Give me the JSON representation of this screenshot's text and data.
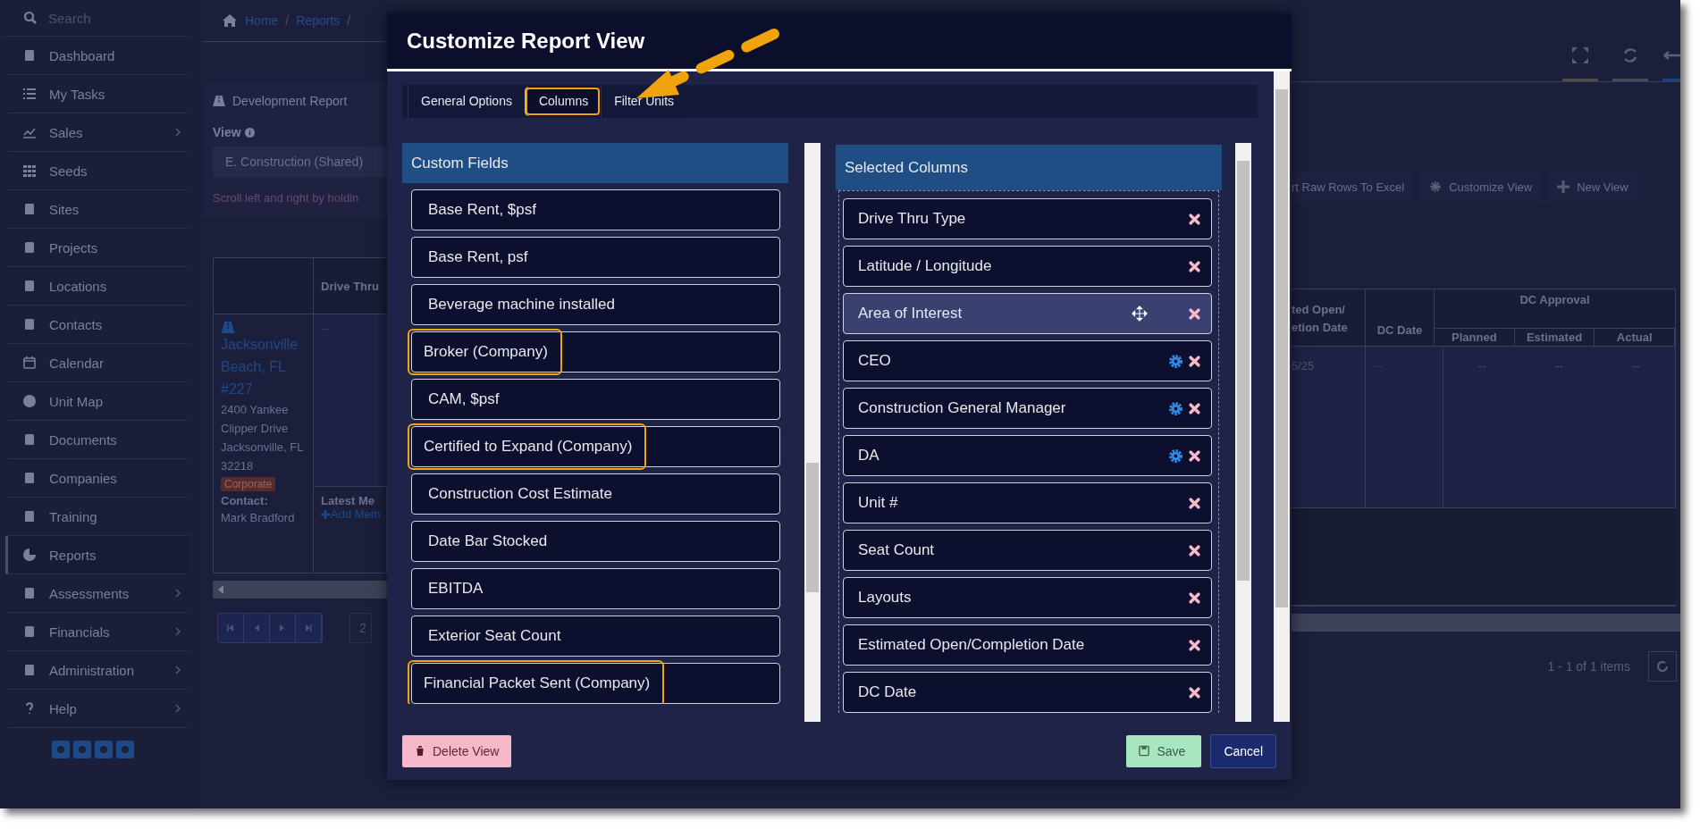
{
  "sidebar": {
    "search_placeholder": "Search",
    "items": [
      {
        "label": "Dashboard",
        "submenu": false,
        "selected": false
      },
      {
        "label": "My Tasks",
        "submenu": false,
        "selected": false
      },
      {
        "label": "Sales",
        "submenu": true,
        "selected": false
      },
      {
        "label": "Seeds",
        "submenu": false,
        "selected": false
      },
      {
        "label": "Sites",
        "submenu": false,
        "selected": false
      },
      {
        "label": "Projects",
        "submenu": false,
        "selected": false
      },
      {
        "label": "Locations",
        "submenu": false,
        "selected": false
      },
      {
        "label": "Contacts",
        "submenu": false,
        "selected": false
      },
      {
        "label": "Calendar",
        "submenu": false,
        "selected": false
      },
      {
        "label": "Unit Map",
        "submenu": false,
        "selected": false
      },
      {
        "label": "Documents",
        "submenu": false,
        "selected": false
      },
      {
        "label": "Companies",
        "submenu": false,
        "selected": false
      },
      {
        "label": "Training",
        "submenu": false,
        "selected": false
      },
      {
        "label": "Reports",
        "submenu": false,
        "selected": true
      },
      {
        "label": "Assessments",
        "submenu": true,
        "selected": false
      },
      {
        "label": "Financials",
        "submenu": true,
        "selected": false
      },
      {
        "label": "Administration",
        "submenu": true,
        "selected": false
      },
      {
        "label": "Help",
        "submenu": true,
        "selected": false
      }
    ]
  },
  "breadcrumb": {
    "items": [
      "Home",
      "Reports"
    ],
    "separator": "/"
  },
  "report": {
    "title": "Development Report",
    "view_label": "View",
    "view_value": "E. Construction (Shared)",
    "hint": "Scroll left and right by holdin"
  },
  "toolbar": [
    {
      "label": "rt Raw Rows To Excel",
      "kind": "plain"
    },
    {
      "label": "Customize View",
      "kind": "gear"
    },
    {
      "label": "New View",
      "kind": "plus"
    }
  ],
  "table": {
    "drive_thru_header": "Drive Thru",
    "unit_link": "Jacksonville Beach, FL #227",
    "address": "2400 Yankee Clipper Drive Jacksonville, FL 32218",
    "tag": "Corporate",
    "contact_label": "Contact:",
    "contact_name": "Mark Bradford",
    "drive_thru_value": "--",
    "memo_label": "Latest Me",
    "memo_link": "Add Mem",
    "est_open_header": [
      "ted Open/",
      "etion Date"
    ],
    "dc_date_header": "DC Date",
    "dc_approval_header": "DC Approval",
    "dc_subcolumns": [
      "Planned",
      "Estimated",
      "Actual"
    ],
    "est_open_value": "5/25",
    "dc_date_value": "--",
    "dc_values": [
      "--",
      "--",
      "--"
    ]
  },
  "pagination": {
    "page": "2",
    "summary": "1 - 1 of 1 items"
  },
  "modal": {
    "title": "Customize Report View",
    "tabs": [
      {
        "label": "General Options",
        "selected": false,
        "highlighted": false
      },
      {
        "label": "Columns",
        "selected": true,
        "highlighted": true
      },
      {
        "label": "Filter Units",
        "selected": false,
        "highlighted": false
      }
    ],
    "custom_fields": {
      "title": "Custom Fields",
      "items": [
        {
          "label": "Base Rent, $psf",
          "highlighted": false
        },
        {
          "label": "Base Rent, psf",
          "highlighted": false
        },
        {
          "label": "Beverage machine installed",
          "highlighted": false
        },
        {
          "label": "Broker (Company)",
          "highlighted": true
        },
        {
          "label": "CAM, $psf",
          "highlighted": false
        },
        {
          "label": "Certified to Expand (Company)",
          "highlighted": true
        },
        {
          "label": "Construction Cost Estimate",
          "highlighted": false
        },
        {
          "label": "Date Bar Stocked",
          "highlighted": false
        },
        {
          "label": "EBITDA",
          "highlighted": false
        },
        {
          "label": "Exterior Seat Count",
          "highlighted": false
        },
        {
          "label": "Financial Packet Sent (Company)",
          "highlighted": true
        }
      ]
    },
    "selected_columns": {
      "title": "Selected Columns",
      "items": [
        {
          "label": "Drive Thru Type",
          "settings": false,
          "hovered": false
        },
        {
          "label": "Latitude / Longitude",
          "settings": false,
          "hovered": false
        },
        {
          "label": "Area of Interest",
          "settings": false,
          "hovered": true
        },
        {
          "label": "CEO",
          "settings": true,
          "hovered": false
        },
        {
          "label": "Construction General Manager",
          "settings": true,
          "hovered": false
        },
        {
          "label": "DA",
          "settings": true,
          "hovered": false
        },
        {
          "label": "Unit #",
          "settings": false,
          "hovered": false
        },
        {
          "label": "Seat Count",
          "settings": false,
          "hovered": false
        },
        {
          "label": "Layouts",
          "settings": false,
          "hovered": false
        },
        {
          "label": "Estimated Open/Completion Date",
          "settings": false,
          "hovered": false
        },
        {
          "label": "DC Date",
          "settings": false,
          "hovered": false
        }
      ]
    },
    "buttons": {
      "delete": "Delete View",
      "save": "Save",
      "cancel": "Cancel"
    }
  }
}
